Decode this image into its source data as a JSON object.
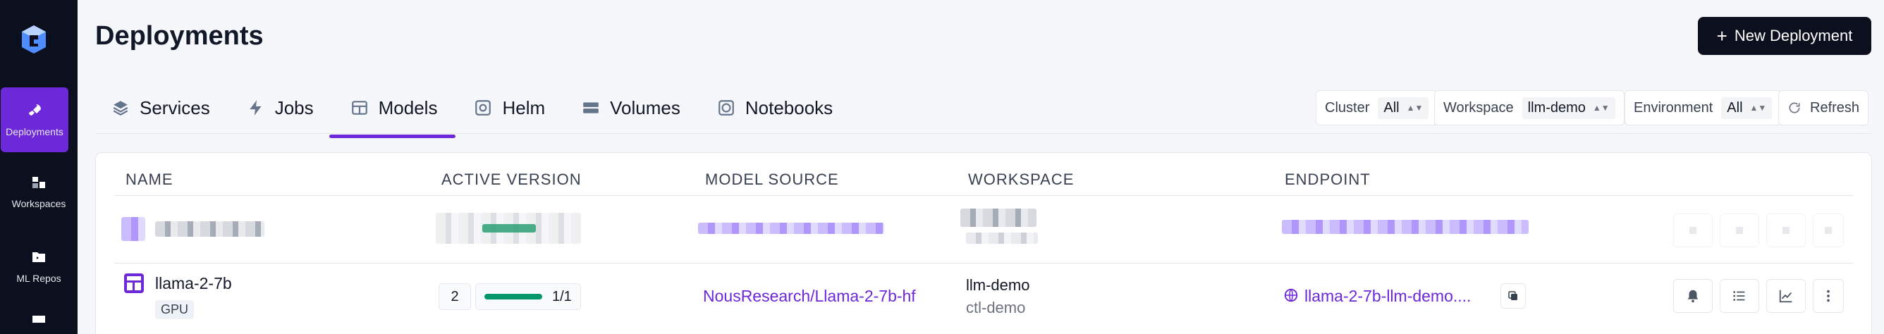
{
  "page": {
    "title": "Deployments"
  },
  "header": {
    "new_button": "New Deployment",
    "new_button_icon": "plus-icon"
  },
  "sidebar": {
    "items": [
      {
        "label": "Deployments",
        "icon": "rocket-icon",
        "active": true
      },
      {
        "label": "Workspaces",
        "icon": "workspace-icon",
        "active": false
      },
      {
        "label": "ML Repos",
        "icon": "folder-icon",
        "active": false
      }
    ]
  },
  "tabs": [
    {
      "label": "Services",
      "icon": "layers-icon"
    },
    {
      "label": "Jobs",
      "icon": "lightning-icon"
    },
    {
      "label": "Models",
      "icon": "table-icon",
      "active": true
    },
    {
      "label": "Helm",
      "icon": "helm-icon"
    },
    {
      "label": "Volumes",
      "icon": "volume-icon"
    },
    {
      "label": "Notebooks",
      "icon": "notebook-icon"
    }
  ],
  "filters": {
    "cluster": {
      "label": "Cluster",
      "value": "All"
    },
    "workspace": {
      "label": "Workspace",
      "value": "llm-demo"
    },
    "environment": {
      "label": "Environment",
      "value": "All"
    },
    "refresh": "Refresh"
  },
  "table": {
    "columns": [
      "NAME",
      "ACTIVE VERSION",
      "MODEL SOURCE",
      "WORKSPACE",
      "ENDPOINT"
    ],
    "rows": [
      {
        "name": "llama-2-7b",
        "badge": "GPU",
        "version": "2",
        "replicas": "1/1",
        "replica_fraction": 1.0,
        "model_source": "NousResearch/Llama-2-7b-hf",
        "workspace": "llm-demo",
        "cluster": "ctl-demo",
        "endpoint": "llama-2-7b-llm-demo....",
        "actions": [
          "bell-icon",
          "list-icon",
          "chart-icon",
          "more-vertical-icon"
        ]
      }
    ]
  },
  "colors": {
    "accent": "#6d28d9",
    "sidebar": "#0b0f1e",
    "success": "#059669"
  }
}
